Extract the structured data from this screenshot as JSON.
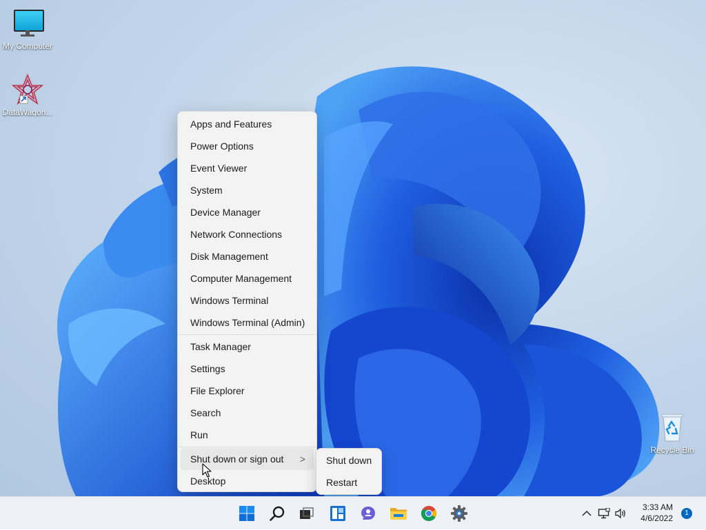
{
  "desktop": {
    "icons": [
      {
        "label": "My Computer",
        "icon": "monitor-icon"
      },
      {
        "label": "DataWagon...",
        "icon": "datawagon-shortcut-icon"
      },
      {
        "label": "Recycle Bin",
        "icon": "recycle-bin-icon"
      }
    ]
  },
  "context_menu": {
    "groups": [
      [
        "Apps and Features",
        "Power Options",
        "Event Viewer",
        "System",
        "Device Manager",
        "Network Connections",
        "Disk Management",
        "Computer Management",
        "Windows Terminal",
        "Windows Terminal (Admin)"
      ],
      [
        "Task Manager",
        "Settings",
        "File Explorer",
        "Search",
        "Run"
      ],
      [
        "Shut down or sign out",
        "Desktop"
      ]
    ],
    "highlighted": "Shut down or sign out",
    "submenu_chevron": ">"
  },
  "submenu": {
    "items": [
      "Shut down",
      "Restart"
    ]
  },
  "taskbar": {
    "apps": [
      "start-icon",
      "search-icon",
      "task-view-icon",
      "widgets-icon",
      "chat-icon",
      "file-explorer-icon",
      "chrome-icon",
      "settings-icon"
    ],
    "tray_icons": [
      "chevron-up-icon",
      "network-icon",
      "volume-icon"
    ],
    "clock_time": "3:33 AM",
    "clock_date": "4/6/2022",
    "notification_count": "1"
  },
  "colors": {
    "accent": "#0067c0",
    "wallpaper_blue": "#1a56d6",
    "menu_background": "#f3f3f3"
  }
}
